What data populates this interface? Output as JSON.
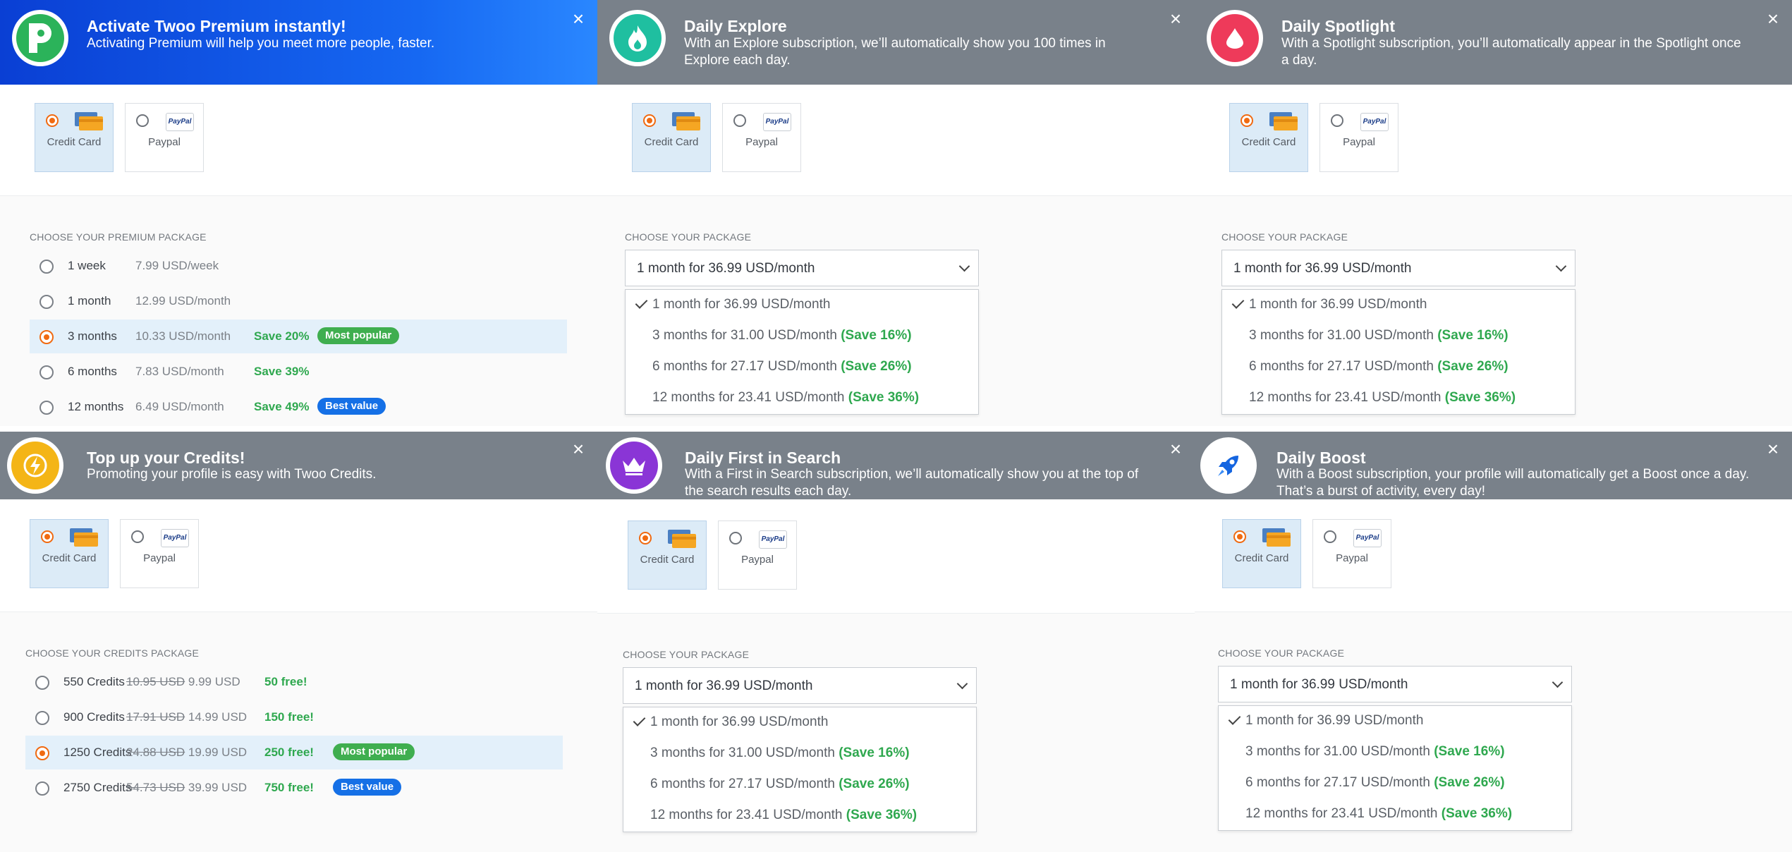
{
  "payment": {
    "credit_card": "Credit Card",
    "paypal": "Paypal",
    "paypal_logo": "PayPal"
  },
  "panels": {
    "premium": {
      "title": "Activate Twoo Premium instantly!",
      "desc": "Activating Premium will help you meet more people, faster.",
      "section_label": "CHOOSE YOUR PREMIUM PACKAGE",
      "packages": [
        {
          "name": "1 week",
          "price": "7.99 USD/week",
          "save": "",
          "badge": ""
        },
        {
          "name": "1 month",
          "price": "12.99 USD/month",
          "save": "",
          "badge": ""
        },
        {
          "name": "3 months",
          "price": "10.33 USD/month",
          "save": "Save 20%",
          "badge": "Most popular"
        },
        {
          "name": "6 months",
          "price": "7.83 USD/month",
          "save": "Save 39%",
          "badge": ""
        },
        {
          "name": "12 months",
          "price": "6.49 USD/month",
          "save": "Save 49%",
          "badge": "Best value"
        }
      ]
    },
    "explore": {
      "title": "Daily Explore",
      "desc": "With an Explore subscription, we’ll automatically show you 100 times in Explore each day.",
      "section_label": "CHOOSE YOUR PACKAGE"
    },
    "spotlight": {
      "title": "Daily Spotlight",
      "desc": "With a Spotlight subscription, you’ll automatically appear in the Spotlight once a day.",
      "section_label": "CHOOSE YOUR PACKAGE"
    },
    "credits": {
      "title": "Top up your Credits!",
      "desc": "Promoting your profile is easy with Twoo Credits.",
      "section_label": "CHOOSE YOUR CREDITS PACKAGE",
      "packages": [
        {
          "name": "550 Credits",
          "old": "10.95 USD",
          "new": "9.99 USD",
          "free": "50 free!",
          "badge": ""
        },
        {
          "name": "900 Credits",
          "old": "17.91 USD",
          "new": "14.99 USD",
          "free": "150 free!",
          "badge": ""
        },
        {
          "name": "1250 Credits",
          "old": "24.88 USD",
          "new": "19.99 USD",
          "free": "250 free!",
          "badge": "Most popular"
        },
        {
          "name": "2750 Credits",
          "old": "54.73 USD",
          "new": "39.99 USD",
          "free": "750 free!",
          "badge": "Best value"
        }
      ]
    },
    "first_search": {
      "title": "Daily First in Search",
      "desc": "With a First in Search subscription, we’ll automatically show you at the top of the search results each day.",
      "section_label": "CHOOSE YOUR PACKAGE"
    },
    "boost": {
      "title": "Daily Boost",
      "desc": "With a Boost subscription, your profile will automatically get a Boost once a day. That’s a burst of activity, every day!",
      "section_label": "CHOOSE YOUR PACKAGE"
    }
  },
  "subscription_options": {
    "selected": "1 month for 36.99 USD/month",
    "options": [
      {
        "text": "1 month for 36.99 USD/month",
        "save": ""
      },
      {
        "text": "3 months for 31.00 USD/month",
        "save": "(Save 16%)"
      },
      {
        "text": "6 months for 27.17 USD/month",
        "save": "(Save 26%)"
      },
      {
        "text": "12 months for 23.41 USD/month",
        "save": "(Save 36%)"
      }
    ]
  },
  "colors": {
    "premium_banner": "#1668f2",
    "grey_banner": "#79818a",
    "explore_icon": "#1fbfa0",
    "spotlight_icon": "#ee3a5a",
    "credits_icon": "#f4b516",
    "first_search_icon": "#8a35d6",
    "boost_icon": "#1565e0",
    "save_green": "#2fa84f",
    "radio_orange": "#f06a11"
  },
  "icons": {
    "premium": "twoo-p-logo-icon",
    "explore": "flame-icon",
    "spotlight": "spotlight-drop-icon",
    "credits": "lightning-bolt-icon",
    "first_search": "crown-icon",
    "boost": "rocket-icon",
    "close": "close-icon",
    "credit_card": "credit-card-icon",
    "paypal": "paypal-logo-icon"
  }
}
